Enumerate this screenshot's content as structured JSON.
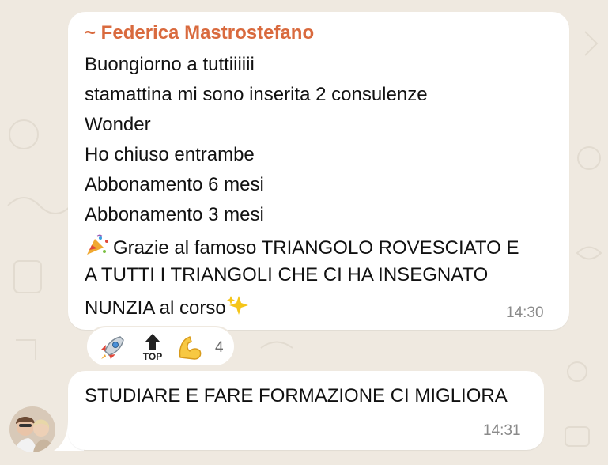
{
  "messages": [
    {
      "sender": "~ Federica Mastrostefano",
      "lines": [
        "Buongiorno a tuttiiiiii",
        "stamattina mi sono inserita 2 consulenze",
        "Wonder",
        "Ho chiuso entrambe",
        "Abbonamento 6 mesi",
        "Abbonamento 3 mesi",
        "Grazie al famoso TRIANGOLO ROVESCIATO E",
        "A TUTTI I TRIANGOLI CHE CI HA INSEGNATO",
        "NUNZIA al corso"
      ],
      "time": "14:30",
      "reactions": {
        "icons": [
          "rocket-emoji",
          "top-arrow-emoji",
          "flexed-biceps-emoji"
        ],
        "top_label": "TOP",
        "count": "4"
      }
    },
    {
      "text": "STUDIARE E FARE FORMAZIONE CI MIGLIORA",
      "time": "14:31"
    }
  ],
  "colors": {
    "background": "#efe9e0",
    "bubble": "#ffffff",
    "sender_name": "#d96a3e",
    "timestamp": "#8a8a8a"
  }
}
